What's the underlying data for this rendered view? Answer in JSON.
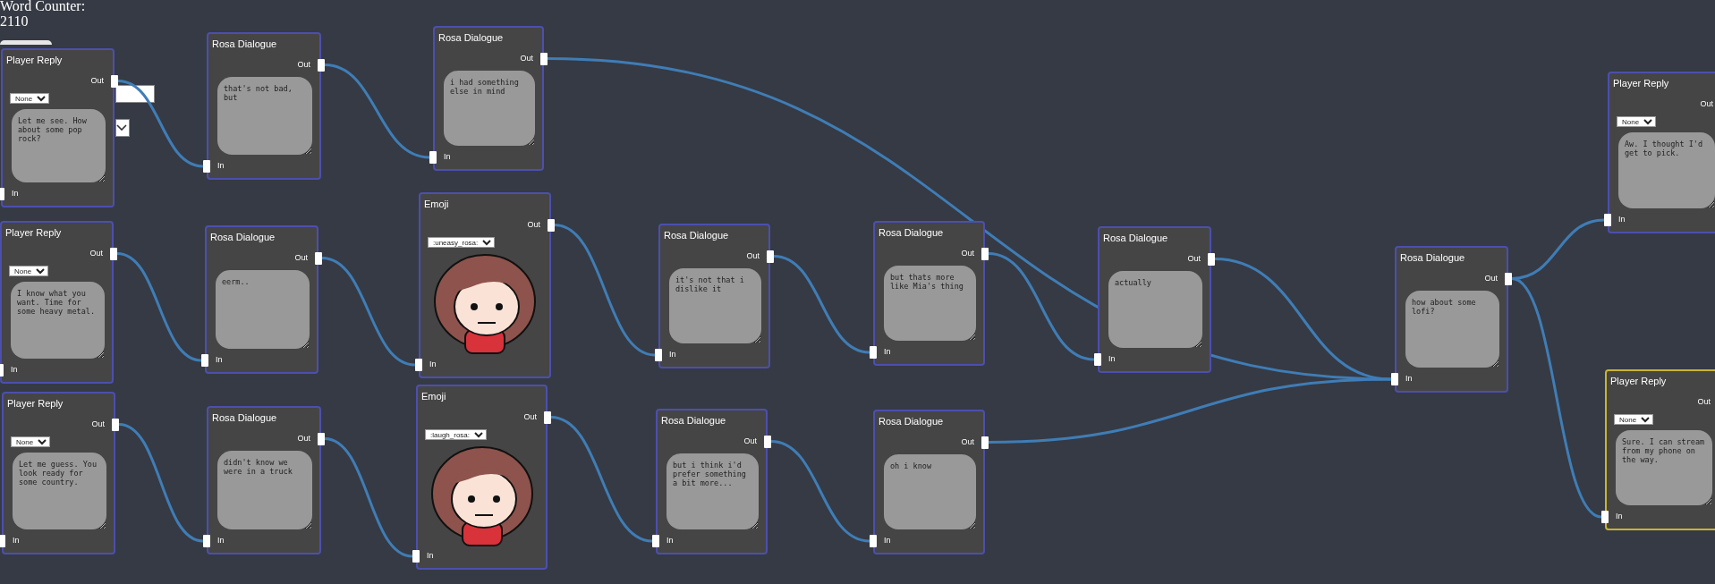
{
  "word_counter": {
    "label": "Word Counter:",
    "count": "2110"
  },
  "toggle": {
    "on": false
  },
  "nodes": [
    {
      "kind": "player_reply",
      "title": "Player Reply",
      "out_label": "Out",
      "in_label": "In",
      "select": "None",
      "text": "Let me see. How about some pop rock?",
      "selected": false
    },
    {
      "kind": "dialogue",
      "title": "Rosa Dialogue",
      "out_label": "Out",
      "in_label": "In",
      "text": "that's not bad, but",
      "selected": false
    },
    {
      "kind": "dialogue",
      "title": "Rosa Dialogue",
      "out_label": "Out",
      "in_label": "In",
      "text": "i had something else in mind",
      "selected": false
    },
    {
      "kind": "player_reply",
      "title": "Player Reply",
      "out_label": "Out",
      "in_label": "In",
      "select": "None",
      "text": "I know what you want. Time for some heavy metal.",
      "selected": false
    },
    {
      "kind": "dialogue",
      "title": "Rosa Dialogue",
      "out_label": "Out",
      "in_label": "In",
      "text": "eerm..",
      "selected": false
    },
    {
      "kind": "emoji",
      "title": "Emoji",
      "out_label": "Out",
      "in_label": "In",
      "select": ":uneasy_rosa:",
      "selected": false
    },
    {
      "kind": "player_reply",
      "title": "Player Reply",
      "out_label": "Out",
      "in_label": "In",
      "select": "None",
      "text": "Let me guess. You look ready for some country.",
      "selected": false
    },
    {
      "kind": "dialogue",
      "title": "Rosa Dialogue",
      "out_label": "Out",
      "in_label": "In",
      "text": "didn't know we were in a truck",
      "selected": false
    },
    {
      "kind": "emoji",
      "title": "Emoji",
      "out_label": "Out",
      "in_label": "In",
      "select": ":laugh_rosa:",
      "selected": false
    },
    {
      "kind": "dialogue",
      "title": "Rosa Dialogue",
      "out_label": "Out",
      "in_label": "In",
      "text": "it's not that i dislike it",
      "selected": false
    },
    {
      "kind": "dialogue",
      "title": "Rosa Dialogue",
      "out_label": "Out",
      "in_label": "In",
      "text": "but thats more like Mia's thing",
      "selected": false
    },
    {
      "kind": "dialogue",
      "title": "Rosa Dialogue",
      "out_label": "Out",
      "in_label": "In",
      "text": "but i think i'd prefer something a bit more...",
      "selected": false
    },
    {
      "kind": "dialogue",
      "title": "Rosa Dialogue",
      "out_label": "Out",
      "in_label": "In",
      "text": "oh i know",
      "selected": false
    },
    {
      "kind": "dialogue",
      "title": "Rosa Dialogue",
      "out_label": "Out",
      "in_label": "In",
      "text": "actually",
      "selected": false
    },
    {
      "kind": "dialogue",
      "title": "Rosa Dialogue",
      "out_label": "Out",
      "in_label": "In",
      "text": "how about some lofi?",
      "selected": false
    },
    {
      "kind": "player_reply",
      "title": "Player Reply",
      "out_label": "Out",
      "in_label": "In",
      "select": "None",
      "text": "Aw. I thought I'd get to pick.",
      "selected": false
    },
    {
      "kind": "player_reply",
      "title": "Player Reply",
      "out_label": "Out",
      "in_label": "In",
      "select": "None",
      "text": "Sure. I can stream from my phone on the way.",
      "selected": true
    }
  ]
}
